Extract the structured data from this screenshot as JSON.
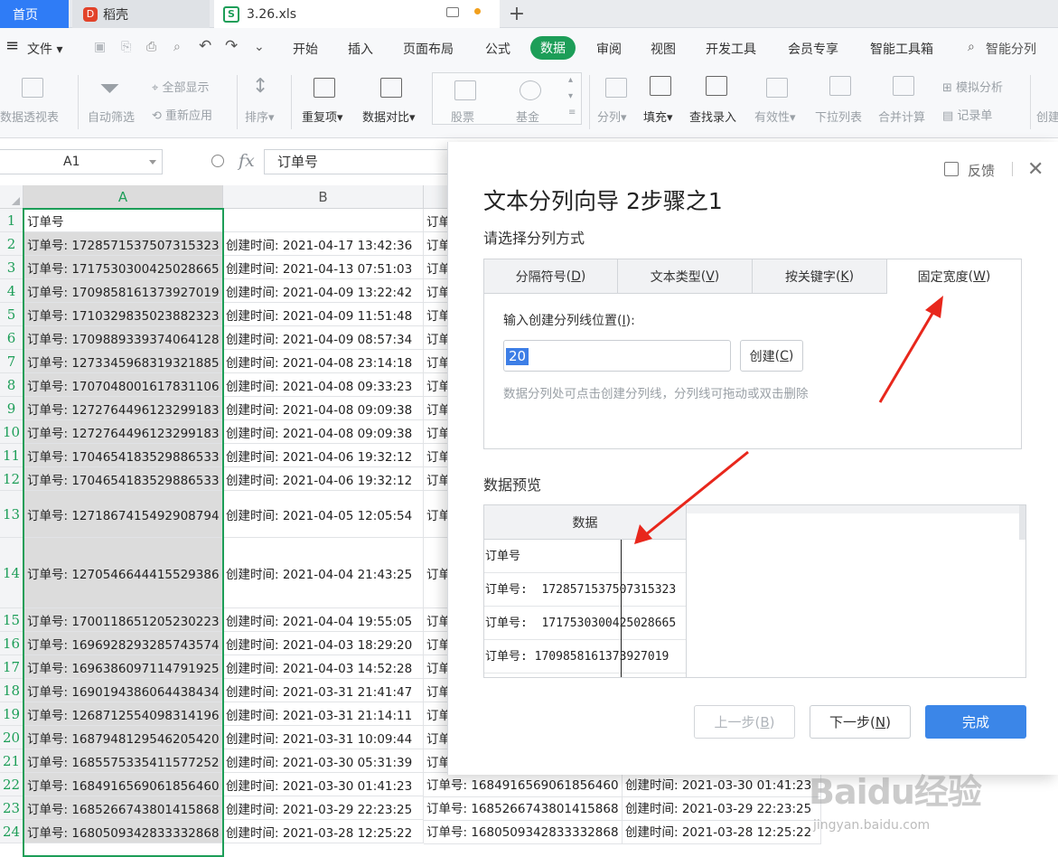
{
  "tabs": {
    "home": "首页",
    "daoke": "稻壳",
    "file": "3.26.xls"
  },
  "menu": {
    "file": "文件",
    "items": [
      "开始",
      "插入",
      "页面布局",
      "公式",
      "数据",
      "审阅",
      "视图",
      "开发工具",
      "会员专享",
      "智能工具箱"
    ],
    "active": "数据",
    "search": "智能分列"
  },
  "ribbon": {
    "pivot": "数据透视表",
    "autofilter": "自动筛选",
    "show_all": "全部显示",
    "reapply": "重新应用",
    "sort": "排序",
    "duplicates": "重复项",
    "compare": "数据对比",
    "stocks": "股票",
    "fund": "基金",
    "split": "分列",
    "fill": "填充",
    "find_entry": "查找录入",
    "validity": "有效性",
    "dropdown": "下拉列表",
    "merge_calc": "合并计算",
    "simulate": "模拟分析",
    "record": "记录单",
    "create": "创建"
  },
  "formula": {
    "cell_ref": "A1",
    "fx": "fx",
    "value": "订单号"
  },
  "sheet": {
    "columns": [
      "A",
      "B"
    ],
    "rows": [
      {
        "n": "1",
        "a": "订单号",
        "b": "",
        "c": "订单"
      },
      {
        "n": "2",
        "a": "订单号: 1728571537507315323",
        "b": "创建时间: 2021-04-17 13:42:36",
        "c": "订单"
      },
      {
        "n": "3",
        "a": "订单号: 1717530300425028665",
        "b": "创建时间: 2021-04-13 07:51:03",
        "c": "订单"
      },
      {
        "n": "4",
        "a": "订单号: 1709858161373927019",
        "b": "创建时间: 2021-04-09 13:22:42",
        "c": "订单"
      },
      {
        "n": "5",
        "a": "订单号: 1710329835023882323",
        "b": "创建时间: 2021-04-09 11:51:48",
        "c": "订单"
      },
      {
        "n": "6",
        "a": "订单号: 1709889339374064128",
        "b": "创建时间: 2021-04-09 08:57:34",
        "c": "订单"
      },
      {
        "n": "7",
        "a": "订单号: 1273345968319321885",
        "b": "创建时间: 2021-04-08 23:14:18",
        "c": "订单"
      },
      {
        "n": "8",
        "a": "订单号: 1707048001617831106",
        "b": "创建时间: 2021-04-08 09:33:23",
        "c": "订单"
      },
      {
        "n": "9",
        "a": "订单号: 1272764496123299183",
        "b": "创建时间: 2021-04-08 09:09:38",
        "c": "订单"
      },
      {
        "n": "10",
        "a": "订单号: 1272764496123299183",
        "b": "创建时间: 2021-04-08 09:09:38",
        "c": "订单"
      },
      {
        "n": "11",
        "a": "订单号: 1704654183529886533",
        "b": "创建时间: 2021-04-06 19:32:12",
        "c": "订单"
      },
      {
        "n": "12",
        "a": "订单号: 1704654183529886533",
        "b": "创建时间: 2021-04-06 19:32:12",
        "c": "订单"
      },
      {
        "n": "13",
        "a": "订单号: 1271867415492908794",
        "b": "创建时间: 2021-04-05 12:05:54",
        "c": "订单"
      },
      {
        "n": "14",
        "a": "订单号: 1270546644415529386",
        "b": "创建时间: 2021-04-04 21:43:25",
        "c": "订单"
      },
      {
        "n": "15",
        "a": "订单号: 1700118651205230223",
        "b": "创建时间: 2021-04-04 19:55:05",
        "c": "订单"
      },
      {
        "n": "16",
        "a": "订单号: 1696928293285743574",
        "b": "创建时间: 2021-04-03 18:29:20",
        "c": "订单"
      },
      {
        "n": "17",
        "a": "订单号: 1696386097114791925",
        "b": "创建时间: 2021-04-03 14:52:28",
        "c": "订单"
      },
      {
        "n": "18",
        "a": "订单号: 1690194386064438434",
        "b": "创建时间: 2021-03-31 21:41:47",
        "c": "订单"
      },
      {
        "n": "19",
        "a": "订单号: 1268712554098314196",
        "b": "创建时间: 2021-03-31 21:14:11",
        "c": "订单"
      },
      {
        "n": "20",
        "a": "订单号: 1687948129546205420",
        "b": "创建时间: 2021-03-31 10:09:44",
        "c": "订单"
      },
      {
        "n": "21",
        "a": "订单号: 1685575335411577252",
        "b": "创建时间: 2021-03-30 05:31:39",
        "c": "订单"
      },
      {
        "n": "22",
        "a": "订单号: 1684916569061856460",
        "b": "创建时间: 2021-03-30 01:41:23",
        "c": ""
      },
      {
        "n": "23",
        "a": "订单号: 1685266743801415868",
        "b": "创建时间: 2021-03-29 22:23:25",
        "c": ""
      },
      {
        "n": "24",
        "a": "订单号: 1680509342833332868",
        "b": "创建时间: 2021-03-28 12:25:22",
        "c": ""
      }
    ],
    "extra": [
      {
        "c": "订单号: 1684916569061856460",
        "d": "创建时间: 2021-03-30 01:41:23"
      },
      {
        "c": "订单号: 1685266743801415868",
        "d": "创建时间: 2021-03-29 22:23:25"
      },
      {
        "c": "订单号: 1680509342833332868",
        "d": "创建时间: 2021-03-28 12:25:22"
      }
    ]
  },
  "dialog": {
    "feedback": "反馈",
    "title": "文本分列向导 2步骤之1",
    "subtitle": "请选择分列方式",
    "tabs": [
      {
        "label": "分隔符号",
        "key": "D"
      },
      {
        "label": "文本类型",
        "key": "V"
      },
      {
        "label": "按关键字",
        "key": "K"
      },
      {
        "label": "固定宽度",
        "key": "W"
      }
    ],
    "input_label": "输入创建分列线位置",
    "input_key": "I",
    "input_value": "20",
    "create_label": "创建",
    "create_key": "C",
    "hint": "数据分列处可点击创建分列线，分列线可拖动或双击删除",
    "preview_label": "数据预览",
    "preview_header": "数据",
    "preview_rows": [
      "订单号",
      "订单号:  1728571537507315323",
      "订单号:  1717530300425028665",
      "订单号: 1709858161373927019"
    ],
    "prev_label": "上一步",
    "prev_key": "B",
    "next_label": "下一步",
    "next_key": "N",
    "done_label": "完成"
  },
  "watermark": {
    "brand": "Baidu经验",
    "url": "jingyan.baidu.com"
  }
}
